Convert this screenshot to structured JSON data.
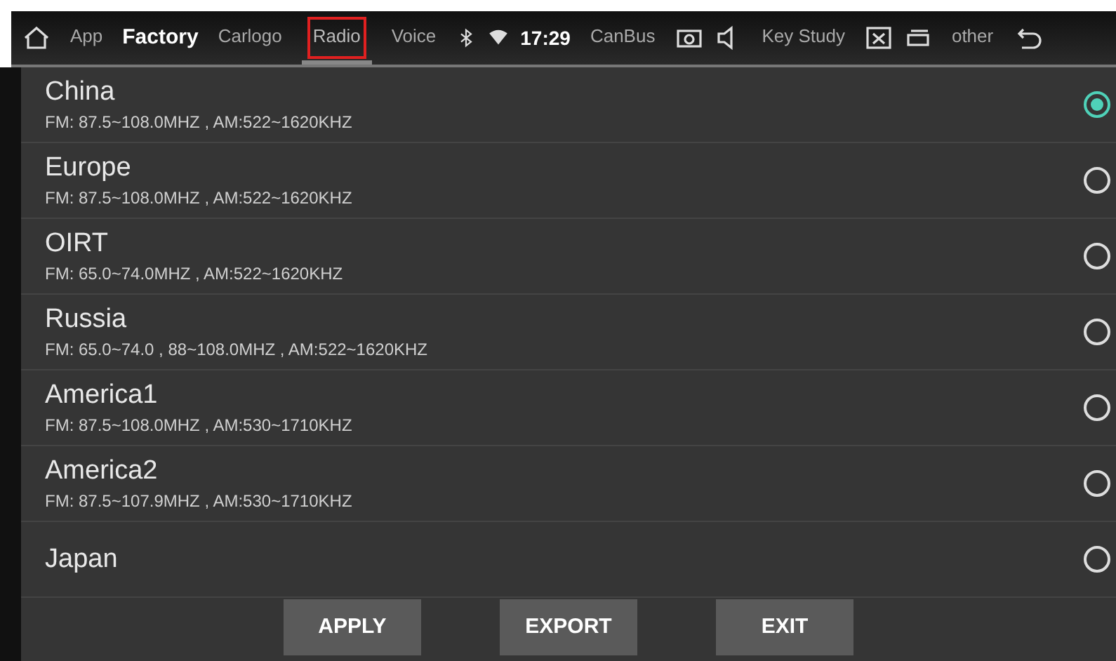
{
  "top_bar": {
    "title": "Factory",
    "time": "17:29",
    "tabs": [
      {
        "label": "App",
        "selected": false,
        "outlined": false
      },
      {
        "label": "Carlogo",
        "selected": false,
        "outlined": false
      },
      {
        "label": "Radio",
        "selected": true,
        "outlined": true
      },
      {
        "label": "Voice",
        "selected": false,
        "outlined": false
      },
      {
        "label": "CanBus",
        "selected": false,
        "outlined": false
      },
      {
        "label": "Key Study",
        "selected": false,
        "outlined": false
      },
      {
        "label": "other",
        "selected": false,
        "outlined": false
      }
    ]
  },
  "regions": [
    {
      "name": "China",
      "range": "FM: 87.5~108.0MHZ , AM:522~1620KHZ",
      "selected": true
    },
    {
      "name": "Europe",
      "range": "FM: 87.5~108.0MHZ , AM:522~1620KHZ",
      "selected": false
    },
    {
      "name": "OIRT",
      "range": "FM: 65.0~74.0MHZ , AM:522~1620KHZ",
      "selected": false
    },
    {
      "name": "Russia",
      "range": "FM: 65.0~74.0 , 88~108.0MHZ , AM:522~1620KHZ",
      "selected": false
    },
    {
      "name": "America1",
      "range": "FM: 87.5~108.0MHZ , AM:530~1710KHZ",
      "selected": false
    },
    {
      "name": "America2",
      "range": "FM: 87.5~107.9MHZ , AM:530~1710KHZ",
      "selected": false
    },
    {
      "name": "Japan",
      "selected": false
    }
  ],
  "buttons": [
    "APPLY",
    "EXPORT",
    "EXIT"
  ]
}
